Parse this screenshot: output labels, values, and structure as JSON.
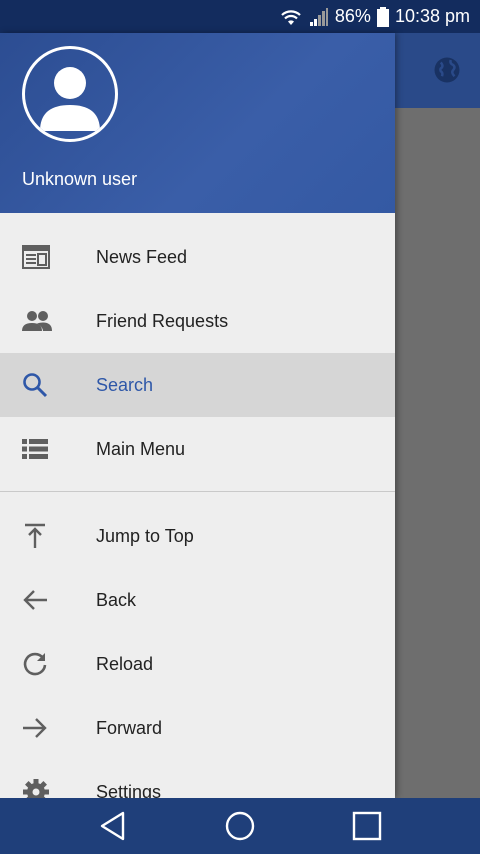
{
  "status_bar": {
    "battery": "86%",
    "time": "10:38 pm"
  },
  "drawer": {
    "user_name": "Unknown user",
    "primary_items": [
      {
        "label": "News Feed",
        "icon": "news-feed-icon"
      },
      {
        "label": "Friend Requests",
        "icon": "friends-icon"
      },
      {
        "label": "Search",
        "icon": "search-icon",
        "active": true
      },
      {
        "label": "Main Menu",
        "icon": "list-icon"
      }
    ],
    "secondary_items": [
      {
        "label": "Jump to Top",
        "icon": "jump-top-icon"
      },
      {
        "label": "Back",
        "icon": "arrow-back-icon"
      },
      {
        "label": "Reload",
        "icon": "reload-icon"
      },
      {
        "label": "Forward",
        "icon": "arrow-forward-icon"
      },
      {
        "label": "Settings",
        "icon": "gear-icon"
      }
    ]
  },
  "colors": {
    "header": "#2c4d92",
    "active_text": "#2e57a8",
    "nav_bar": "#1f3f7a",
    "status_bar": "#132c5e"
  }
}
